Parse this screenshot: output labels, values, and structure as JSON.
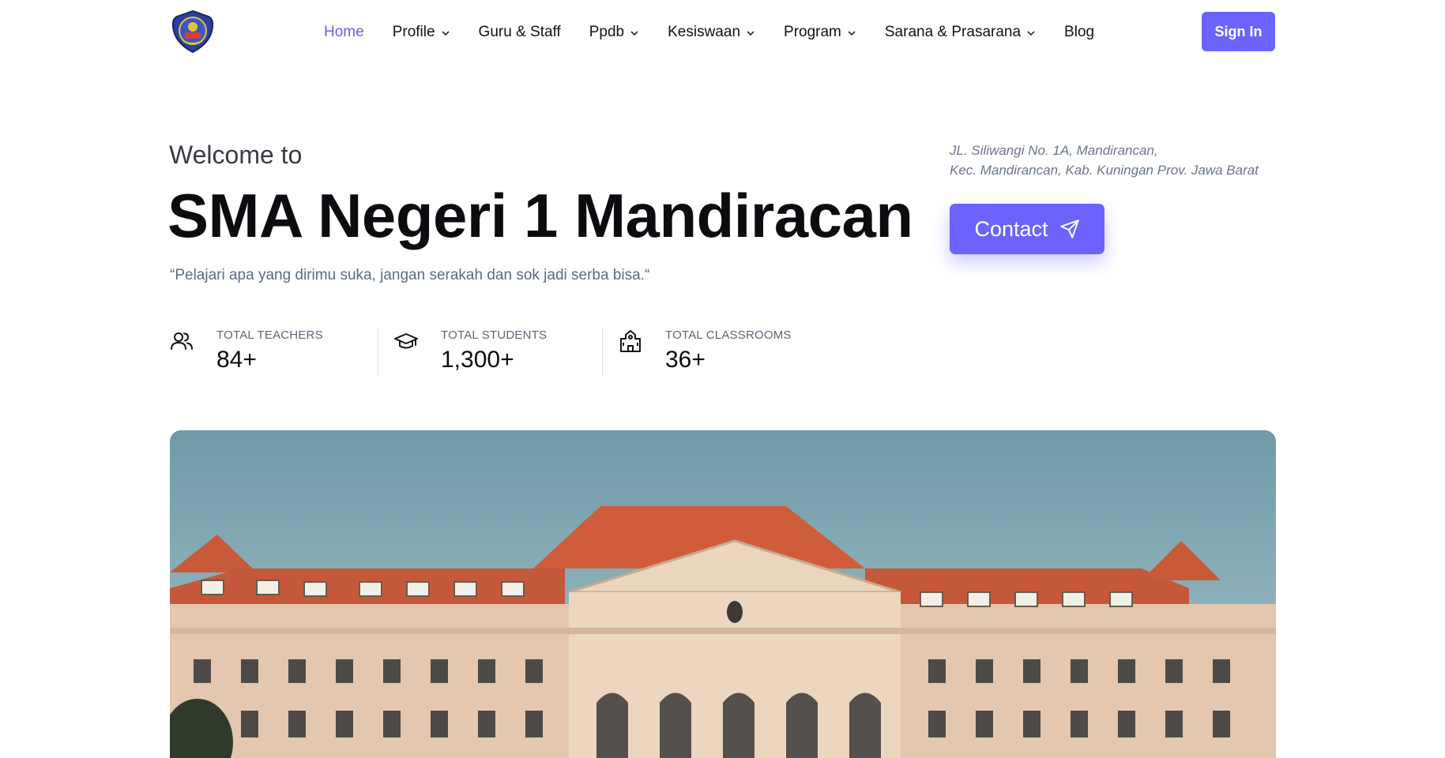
{
  "nav": {
    "items": [
      {
        "label": "Home",
        "active": true,
        "dropdown": false
      },
      {
        "label": "Profile",
        "active": false,
        "dropdown": true
      },
      {
        "label": "Guru & Staff",
        "active": false,
        "dropdown": false
      },
      {
        "label": "Ppdb",
        "active": false,
        "dropdown": true
      },
      {
        "label": "Kesiswaan",
        "active": false,
        "dropdown": true
      },
      {
        "label": "Program",
        "active": false,
        "dropdown": true
      },
      {
        "label": "Sarana & Prasarana",
        "active": false,
        "dropdown": true
      },
      {
        "label": "Blog",
        "active": false,
        "dropdown": false
      }
    ],
    "signin_label": "Sign In"
  },
  "hero": {
    "welcome": "Welcome to",
    "school_name": "SMA Negeri 1 Mandiracan",
    "motto": "“Pelajari apa yang dirimu suka, jangan serakah dan sok jadi serba bisa.“",
    "address_line1": "JL. Siliwangi No. 1A, Mandirancan,",
    "address_line2": "Kec. Mandirancan, Kab. Kuningan Prov. Jawa Barat",
    "contact_label": "Contact"
  },
  "stats": [
    {
      "icon": "users-icon",
      "label": "TOTAL TEACHERS",
      "value": "84+"
    },
    {
      "icon": "graduation-cap-icon",
      "label": "TOTAL STUDENTS",
      "value": "1,300+"
    },
    {
      "icon": "school-building-icon",
      "label": "TOTAL CLASSROOMS",
      "value": "36+"
    }
  ],
  "colors": {
    "accent": "#6c63ff",
    "active_nav": "#6c5ce7",
    "muted_text": "#5d6b7e"
  }
}
